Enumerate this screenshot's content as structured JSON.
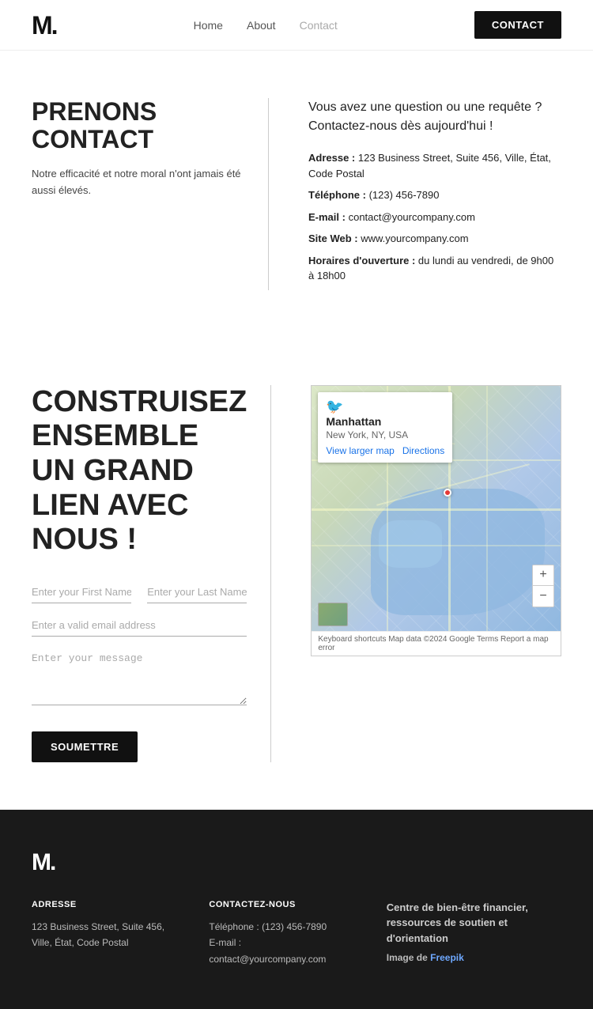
{
  "header": {
    "logo": "M.",
    "nav": [
      {
        "label": "Home",
        "active": false
      },
      {
        "label": "About",
        "active": false
      },
      {
        "label": "Contact",
        "active": true
      }
    ],
    "contact_button": "CONTACT"
  },
  "prenons": {
    "title": "PRENONS CONTACT",
    "subtitle": "Notre efficacité et notre moral n'ont jamais été aussi élevés.",
    "intro": "Vous avez une question ou une requête ? Contactez-nous dès aujourd'hui !",
    "address_label": "Adresse :",
    "address_value": "123 Business Street, Suite 456, Ville, État, Code Postal",
    "phone_label": "Téléphone :",
    "phone_value": "(123) 456-7890",
    "email_label": "E-mail :",
    "email_value": "contact@yourcompany.com",
    "web_label": "Site Web :",
    "web_value": "www.yourcompany.com",
    "hours_label": "Horaires d'ouverture :",
    "hours_value": "du lundi au vendredi, de 9h00 à 18h00"
  },
  "construisez": {
    "title": "CONSTRUISEZ ENSEMBLE UN GRAND LIEN AVEC NOUS !",
    "form": {
      "first_name_placeholder": "Enter your First Name",
      "last_name_placeholder": "Enter your Last Name",
      "email_placeholder": "Enter a valid email address",
      "message_placeholder": "Enter your message",
      "submit_label": "SOUMETTRE"
    },
    "map": {
      "place_name": "Manhattan",
      "place_sub": "New York, NY, USA",
      "view_link": "View larger map",
      "directions": "Directions",
      "zoom_in": "+",
      "zoom_out": "−",
      "footer": "Keyboard shortcuts   Map data ©2024 Google   Terms   Report a map error"
    }
  },
  "footer": {
    "logo": "M.",
    "adresse_title": "ADRESSE",
    "adresse_text": "123 Business Street, Suite 456, Ville, État, Code Postal",
    "contact_title": "CONTACTEZ-NOUS",
    "phone_text": "Téléphone : (123) 456-7890",
    "email_text": "E-mail : contact@yourcompany.com",
    "right_title": "Centre de bien-être financier, ressources de soutien et d'orientation",
    "image_text": "Image de",
    "freepik_link": "Freepik"
  }
}
